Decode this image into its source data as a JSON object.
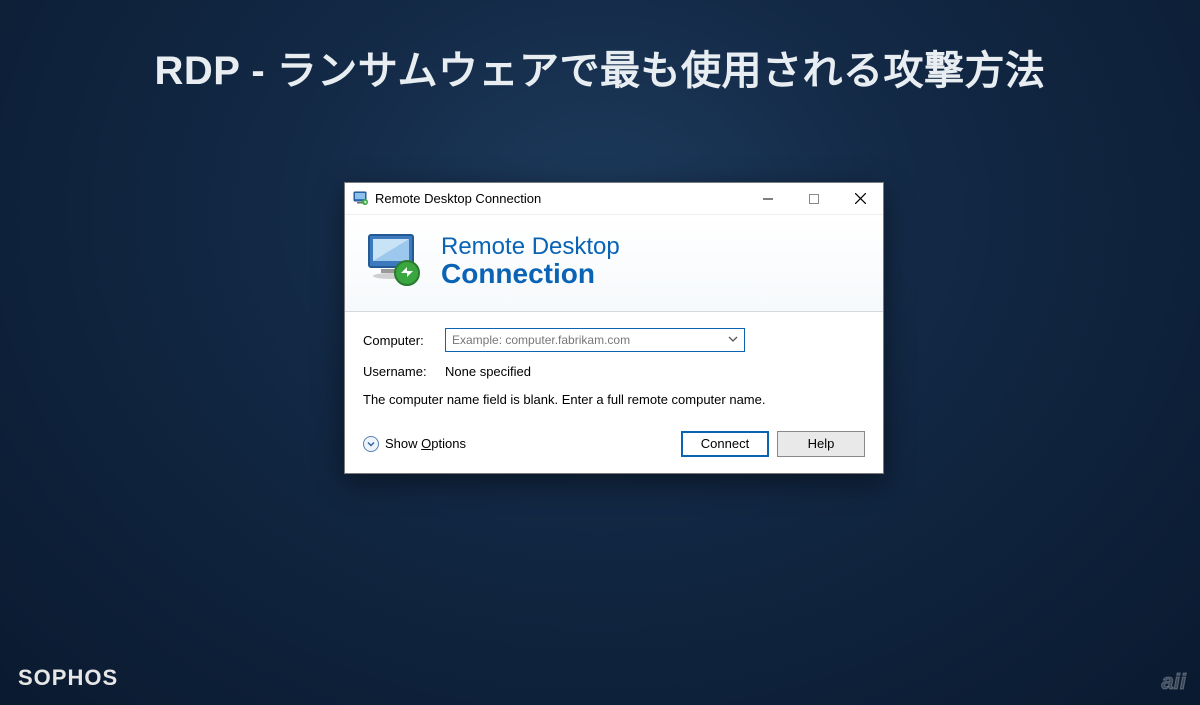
{
  "slide": {
    "title": "RDP - ランサムウェアで最も使用される攻撃方法",
    "brand": "SOPHOS",
    "watermark": "aii"
  },
  "dialog": {
    "window_title": "Remote Desktop Connection",
    "header_line1": "Remote Desktop",
    "header_line2": "Connection",
    "computer_label": "Computer:",
    "computer_placeholder": "Example: computer.fabrikam.com",
    "username_label": "Username:",
    "username_value": "None specified",
    "hint": "The computer name field is blank. Enter a full remote computer name.",
    "show_options": "Show Options",
    "connect": "Connect",
    "help": "Help"
  }
}
